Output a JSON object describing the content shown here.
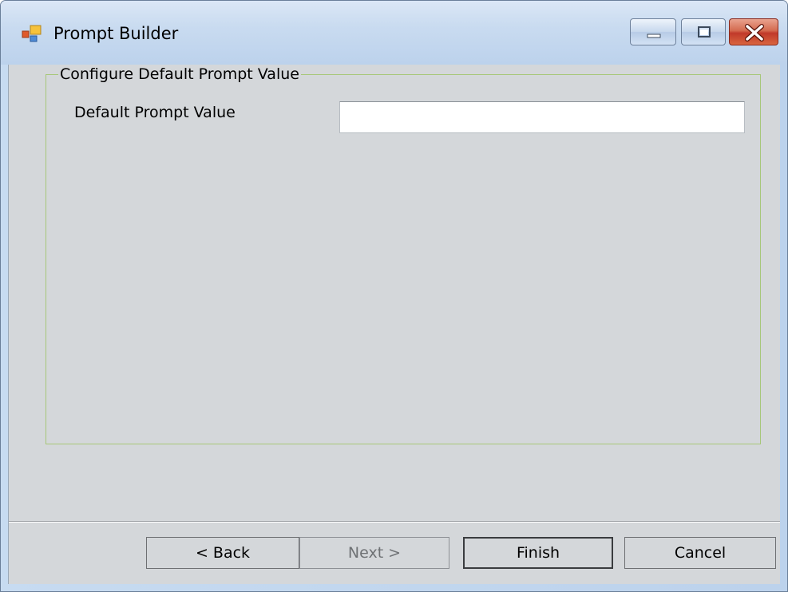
{
  "window": {
    "title": "Prompt Builder",
    "controls": {
      "minimize": "minimize-icon",
      "maximize": "maximize-icon",
      "close": "close-icon"
    }
  },
  "group": {
    "legend": "Configure Default Prompt Value",
    "field_label": "Default Prompt Value",
    "field_value": "",
    "field_placeholder": ""
  },
  "buttons": {
    "back": "< Back",
    "next": "Next >",
    "finish": "Finish",
    "cancel": "Cancel"
  },
  "colors": {
    "client_bg": "#d4d7da",
    "groupbox_border": "#a7c779",
    "titlebar": "#c9dbf0",
    "close_button": "#c1392a"
  }
}
